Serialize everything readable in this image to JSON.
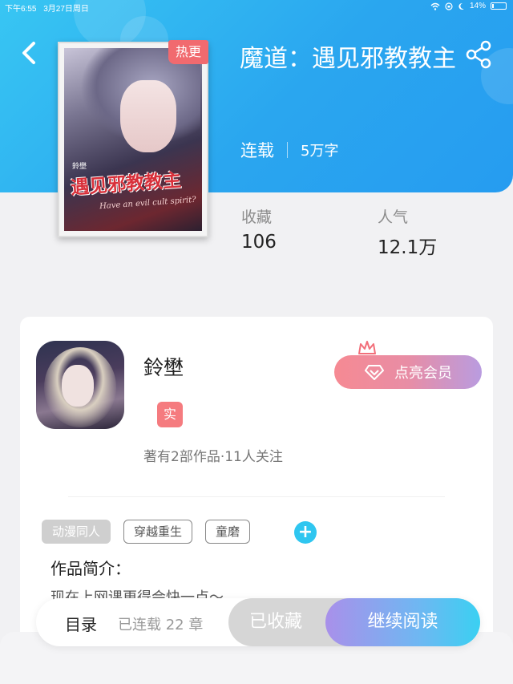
{
  "status_bar": {
    "time": "下午6:55",
    "date": "3月27日周日",
    "battery": "14%",
    "battery_level": 0.14
  },
  "book": {
    "hot_badge": "热更",
    "title": "魔道：遇见邪教教主",
    "status": "连载",
    "words": "5万字",
    "cover_title": "遇见邪教教主",
    "cover_subtitle": "Have an evil cult spirit?",
    "cover_author": "鈴壄"
  },
  "stats": {
    "favorites_label": "收藏",
    "favorites_value": "106",
    "popularity_label": "人气",
    "popularity_value": "12.1万"
  },
  "author": {
    "name": "鈴壄",
    "badge": "实",
    "stats_text": "著有2部作品·11人关注",
    "vip_label": "点亮会员"
  },
  "tags": [
    {
      "label": "动漫同人"
    },
    {
      "label": "穿越重生"
    },
    {
      "label": "童磨"
    }
  ],
  "tag_add_symbol": "+",
  "intro": {
    "heading": "作品简介：",
    "text": "现在上网课更得会快一点～"
  },
  "bottom_bar": {
    "toc_label": "目录",
    "chapter_count": "已连载 22 章",
    "collected_label": "已收藏",
    "read_label": "继续阅读"
  },
  "colors": {
    "hero_gradient_start": "#38c6f3",
    "hero_gradient_end": "#269cf0",
    "hot_badge": "#f16a6f",
    "accent_blue": "#2fc6f0"
  },
  "icons": [
    "back-icon",
    "share-icon",
    "wifi-icon",
    "battery-icon",
    "crown-icon",
    "diamond-icon",
    "plus-icon"
  ]
}
